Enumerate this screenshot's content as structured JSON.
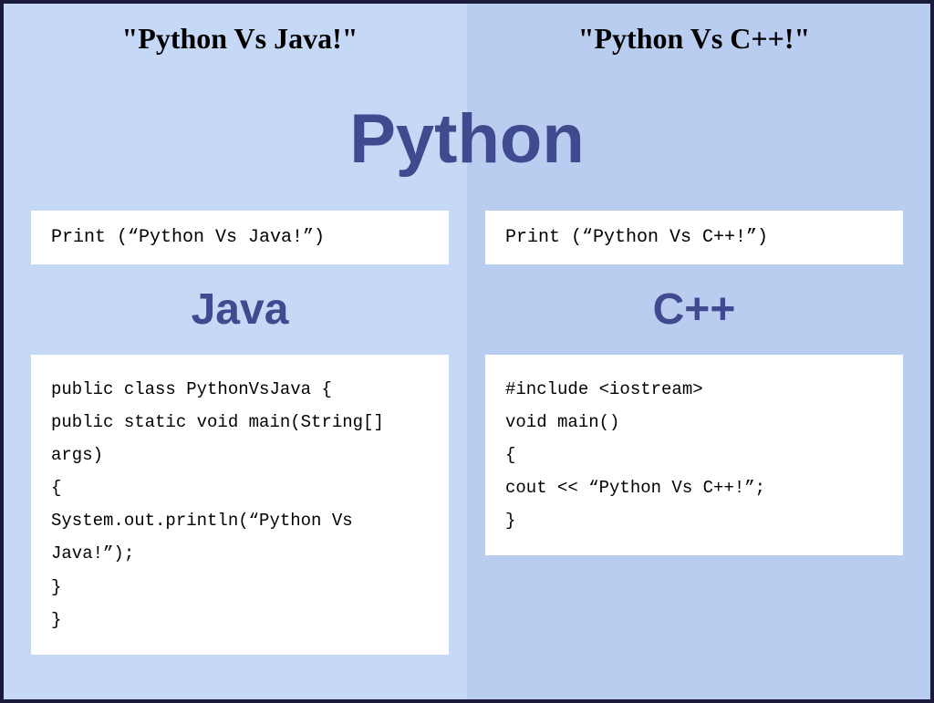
{
  "left": {
    "topTitle": "\"Python Vs Java!\"",
    "pythonCode": "Print (“Python Vs Java!”)",
    "langHeading": "Java",
    "langCode": "public class PythonVsJava {\npublic static void main(String[] args)\n{\nSystem.out.println(“Python Vs Java!”);\n}\n}"
  },
  "right": {
    "topTitle": "\"Python Vs C++!\"",
    "pythonCode": "Print (“Python Vs C++!”)",
    "langHeading": "C++",
    "langCode": "#include <iostream>\nvoid main()\n{\ncout << “Python Vs C++!”;\n}"
  },
  "centerHeading": "Python"
}
